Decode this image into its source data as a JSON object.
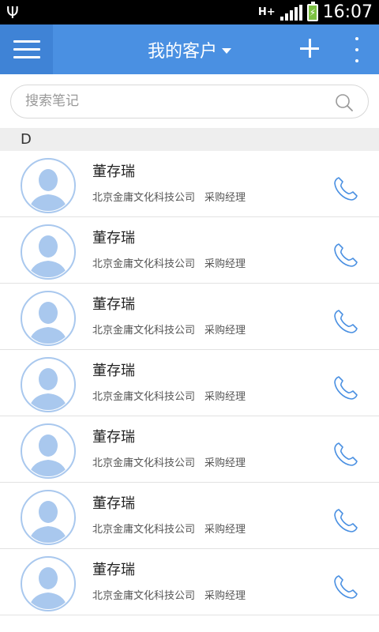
{
  "status_bar": {
    "network": "H+",
    "time": "16:07"
  },
  "app_bar": {
    "title": "我的客户",
    "icons": [
      "menu-icon",
      "chevron-down-icon",
      "add-icon",
      "more-vert-icon"
    ],
    "accent_color": "#4a90e2"
  },
  "search": {
    "placeholder": "搜索笔记"
  },
  "section": {
    "letter": "D"
  },
  "contacts": [
    {
      "name": "董存瑞",
      "company": "北京金庸文化科技公司",
      "title": "采购经理"
    },
    {
      "name": "董存瑞",
      "company": "北京金庸文化科技公司",
      "title": "采购经理"
    },
    {
      "name": "董存瑞",
      "company": "北京金庸文化科技公司",
      "title": "采购经理"
    },
    {
      "name": "董存瑞",
      "company": "北京金庸文化科技公司",
      "title": "采购经理"
    },
    {
      "name": "董存瑞",
      "company": "北京金庸文化科技公司",
      "title": "采购经理"
    },
    {
      "name": "董存瑞",
      "company": "北京金庸文化科技公司",
      "title": "采购经理"
    },
    {
      "name": "董存瑞",
      "company": "北京金庸文化科技公司",
      "title": "采购经理"
    }
  ]
}
